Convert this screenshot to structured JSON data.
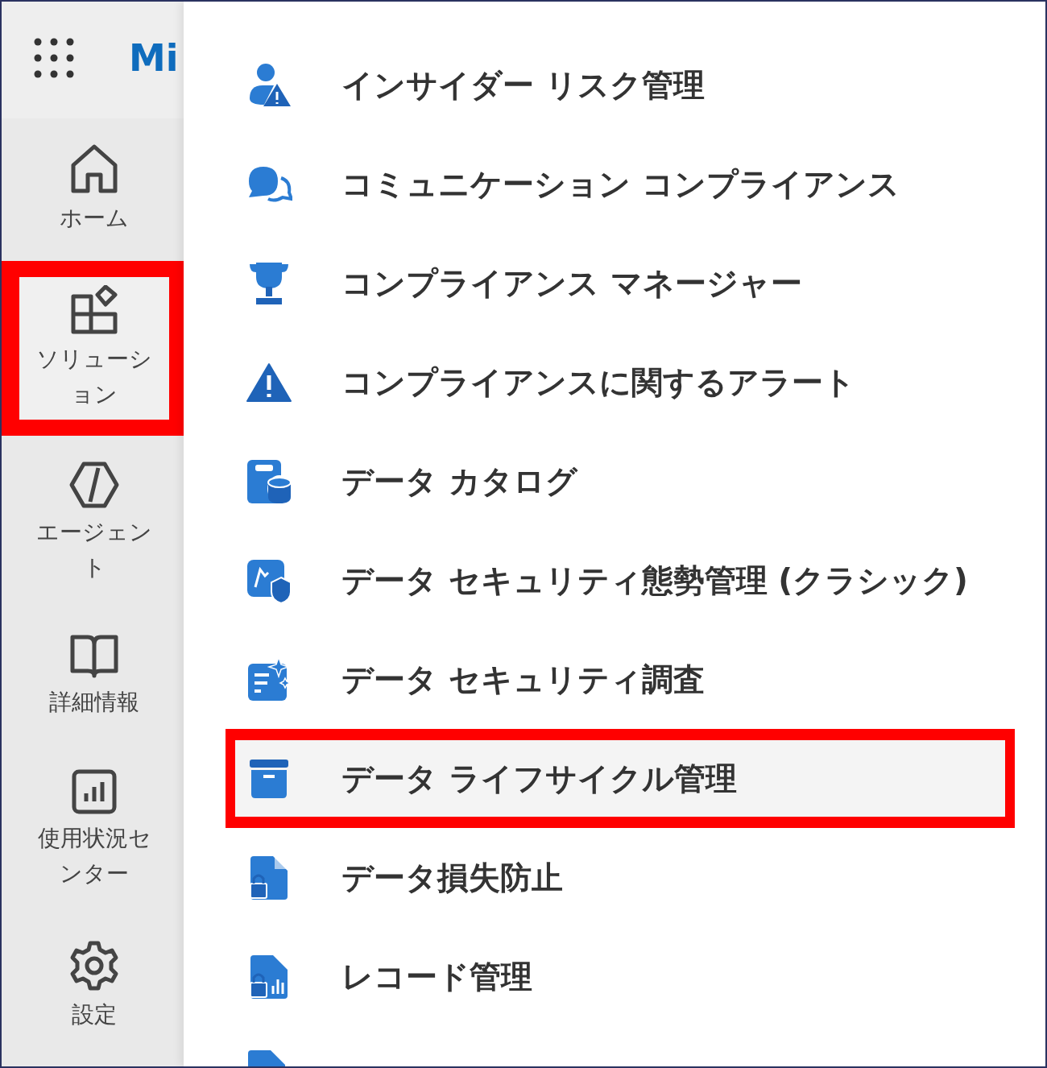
{
  "header": {
    "app_title": "Mi"
  },
  "rail": {
    "items": [
      {
        "label": "ホーム",
        "highlighted": false
      },
      {
        "label": "ソリューション",
        "highlighted": true
      },
      {
        "label": "エージェント",
        "highlighted": false
      },
      {
        "label": "詳細情報",
        "highlighted": false
      },
      {
        "label": "使用状況センター",
        "highlighted": false
      },
      {
        "label": "設定",
        "highlighted": false
      }
    ]
  },
  "menu": {
    "items": [
      {
        "label": "インサイダー リスク管理",
        "highlighted": false
      },
      {
        "label": "コミュニケーション コンプライアンス",
        "highlighted": false
      },
      {
        "label": "コンプライアンス マネージャー",
        "highlighted": false
      },
      {
        "label": "コンプライアンスに関するアラート",
        "highlighted": false
      },
      {
        "label": "データ カタログ",
        "highlighted": false
      },
      {
        "label": "データ セキュリティ態勢管理 (クラシック)",
        "highlighted": false
      },
      {
        "label": "データ セキュリティ調査",
        "highlighted": false
      },
      {
        "label": "データ ライフサイクル管理",
        "highlighted": true
      },
      {
        "label": "データ損失防止",
        "highlighted": false
      },
      {
        "label": "レコード管理",
        "highlighted": false
      }
    ]
  }
}
